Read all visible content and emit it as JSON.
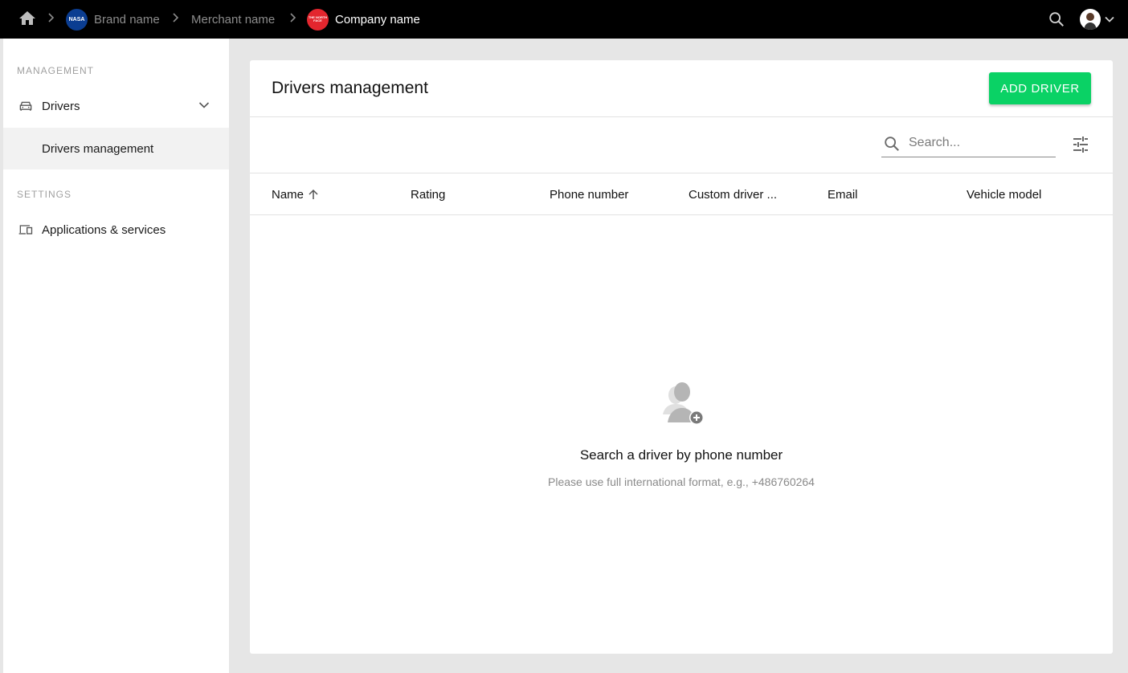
{
  "breadcrumb": {
    "items": [
      {
        "label": "Brand name",
        "logo_text": "NASA",
        "logo_color": "#0b3d91"
      },
      {
        "label": "Merchant name"
      },
      {
        "label": "Company name",
        "logo_text": "THE NORTH FACE",
        "logo_color": "#e3262e"
      }
    ]
  },
  "sidebar": {
    "management_title": "MANAGEMENT",
    "settings_title": "SETTINGS",
    "drivers_label": "Drivers",
    "drivers_management_label": "Drivers management",
    "applications_label": "Applications & services"
  },
  "main": {
    "title": "Drivers management",
    "add_button": "ADD DRIVER",
    "search_placeholder": "Search...",
    "columns": [
      "Name",
      "Rating",
      "Phone number",
      "Custom driver ...",
      "Email",
      "Vehicle model"
    ],
    "empty_title": "Search a driver by phone number",
    "empty_subtitle": "Please use full international format, e.g., +486760264"
  },
  "colors": {
    "accent": "#0ad265",
    "topbar": "#000000"
  }
}
